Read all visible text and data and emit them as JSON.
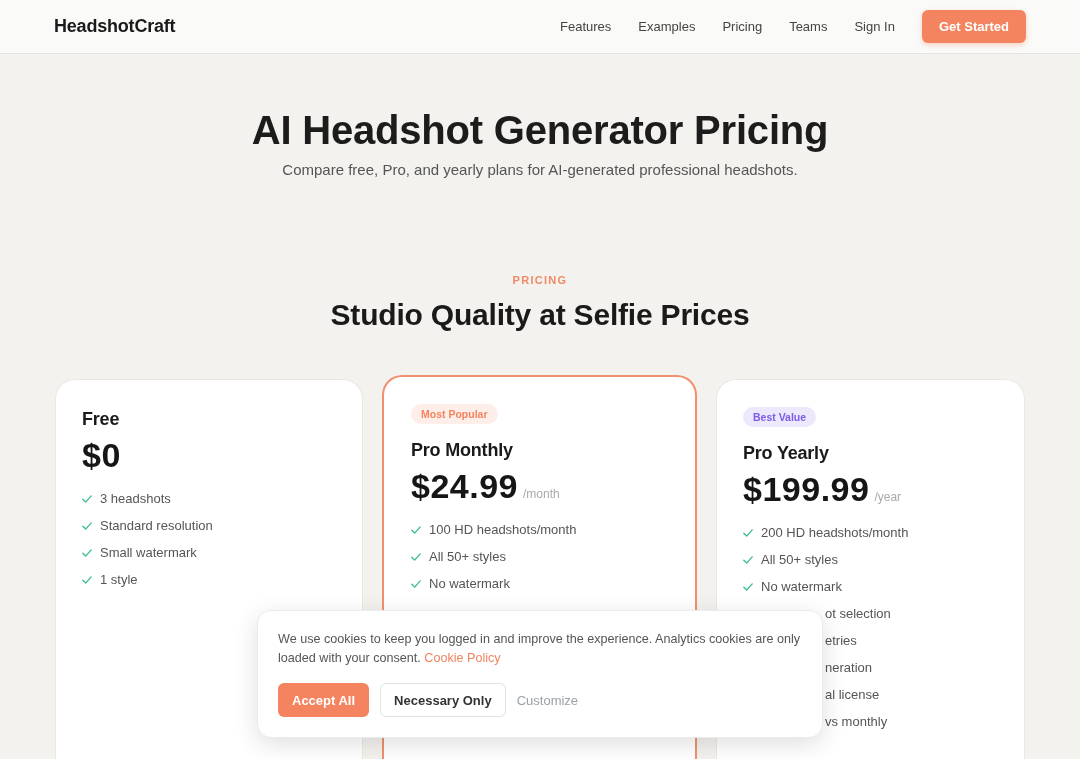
{
  "header": {
    "logo": "HeadshotCraft",
    "nav": [
      "Features",
      "Examples",
      "Pricing",
      "Teams",
      "Sign In"
    ],
    "cta": "Get Started"
  },
  "hero": {
    "title": "AI Headshot Generator Pricing",
    "subtitle": "Compare free, Pro, and yearly plans for AI-generated professional headshots."
  },
  "pricing": {
    "eyebrow": "PRICING",
    "heading": "Studio Quality at Selfie Prices",
    "plans": [
      {
        "name": "Free",
        "price": "$0",
        "featured": false,
        "features": [
          {
            "kind": "check",
            "text": "3 headshots"
          },
          {
            "kind": "check",
            "text": "Standard resolution"
          },
          {
            "kind": "check",
            "text": "Small watermark"
          },
          {
            "kind": "check",
            "text": "1 style"
          }
        ]
      },
      {
        "badge": {
          "label": "Most Popular",
          "color": "#f4845f"
        },
        "name": "Pro Monthly",
        "price": "$24.99",
        "period": "/month",
        "featured": true,
        "features": [
          {
            "kind": "check",
            "text": "100 HD headshots/month"
          },
          {
            "kind": "check",
            "text": "All 50+ styles"
          },
          {
            "kind": "check",
            "text": "No watermark"
          }
        ]
      },
      {
        "badge": {
          "label": "Best Value",
          "color": "#7c5ce8"
        },
        "name": "Pro Yearly",
        "price": "$199.99",
        "period": "/year",
        "featured": false,
        "features": [
          {
            "kind": "check",
            "text": "200 HD headshots/month"
          },
          {
            "kind": "check",
            "text": "All 50+ styles"
          },
          {
            "kind": "check",
            "text": "No watermark"
          },
          {
            "kind": "partial",
            "text": "ot selection"
          },
          {
            "kind": "partial",
            "text": "etries"
          },
          {
            "kind": "partial",
            "text": "neration"
          },
          {
            "kind": "partial",
            "text": "al license"
          },
          {
            "kind": "partial",
            "text": "vs monthly"
          }
        ]
      }
    ]
  },
  "cookie_banner": {
    "text": "We use cookies to keep you logged in and improve the experience. Analytics cookies are only loaded with your consent.",
    "link": "Cookie Policy",
    "buttons": [
      {
        "kind": "primary",
        "label": "Accept All"
      },
      {
        "kind": "secondary",
        "label": "Necessary Only"
      },
      {
        "kind": "text",
        "label": "Customize"
      }
    ]
  }
}
